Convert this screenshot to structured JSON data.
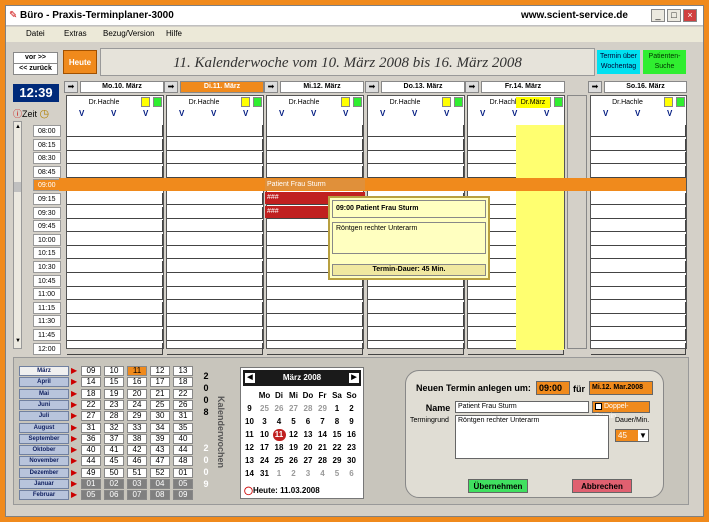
{
  "titlebar": {
    "title": "Büro - Praxis-Terminplaner-3000",
    "url": "www.scient-service.de"
  },
  "menu": [
    "Datei",
    "Extras",
    "Bezug/Version",
    "Hilfe"
  ],
  "nav": {
    "fwd": "vor >>",
    "back": "<< zurück",
    "today": "Heute"
  },
  "week": {
    "label": "11.  Kalenderwoche  vom  10. März 2008  bis   16. März 2008"
  },
  "buttons": {
    "termin_ueber": "Termin über Wochentag",
    "patienten": "Patienten-Suche"
  },
  "clock": "12:39",
  "zeit_label": "Zeit",
  "times": [
    "08:00",
    "08:15",
    "08:30",
    "08:45",
    "09:00",
    "09:15",
    "09:30",
    "09:45",
    "10:00",
    "10:15",
    "10:30",
    "10:45",
    "11:00",
    "11:15",
    "11:30",
    "11:45",
    "12:00"
  ],
  "days": [
    "Mo.10. März",
    "Di.11. März",
    "Mi.12. März",
    "Do.13. März",
    "Fr.14. März",
    "So.16. März"
  ],
  "doctor": "Dr.Hachle",
  "doctor2": "Dr.März",
  "v": "V",
  "appointment": {
    "short": "Patient Frau Sturm",
    "marker": "###"
  },
  "popup": {
    "head": "09:00   Patient Frau Sturm",
    "body": "Röntgen rechter Unterarm",
    "foot": "Termin-Dauer:  45 Min."
  },
  "months": [
    "März",
    "April",
    "Mai",
    "Juni",
    "Juli",
    "August",
    "September",
    "Oktober",
    "November",
    "Dezember",
    "Januar",
    "Februar"
  ],
  "kw": [
    [
      "09",
      "10",
      "11",
      "12",
      "13"
    ],
    [
      "14",
      "15",
      "16",
      "17",
      "18"
    ],
    [
      "18",
      "19",
      "20",
      "21",
      "22"
    ],
    [
      "22",
      "23",
      "24",
      "25",
      "26"
    ],
    [
      "27",
      "28",
      "29",
      "30",
      "31"
    ],
    [
      "31",
      "32",
      "33",
      "34",
      "35"
    ],
    [
      "36",
      "37",
      "38",
      "39",
      "40"
    ],
    [
      "40",
      "41",
      "42",
      "43",
      "44"
    ],
    [
      "44",
      "45",
      "46",
      "47",
      "48"
    ],
    [
      "49",
      "50",
      "51",
      "52",
      "01"
    ],
    [
      "01",
      "02",
      "03",
      "04",
      "05"
    ],
    [
      "05",
      "06",
      "07",
      "08",
      "09"
    ]
  ],
  "year_digits": [
    "2",
    "0",
    "0",
    "8"
  ],
  "year_digits2": [
    "2",
    "0",
    "0",
    "9"
  ],
  "kw_label": "Kalenderwochen",
  "calendar": {
    "title": "März 2008",
    "weekdays": [
      "Mo",
      "Di",
      "Mi",
      "Do",
      "Fr",
      "Sa",
      "So"
    ],
    "weeknums": [
      "9",
      "10",
      "11",
      "12",
      "13",
      "14"
    ],
    "rows": [
      [
        "25",
        "26",
        "27",
        "28",
        "29",
        "1",
        "2"
      ],
      [
        "3",
        "4",
        "5",
        "6",
        "7",
        "8",
        "9"
      ],
      [
        "10",
        "11",
        "12",
        "13",
        "14",
        "15",
        "16"
      ],
      [
        "17",
        "18",
        "19",
        "20",
        "21",
        "22",
        "23"
      ],
      [
        "24",
        "25",
        "26",
        "27",
        "28",
        "29",
        "30"
      ],
      [
        "31",
        "1",
        "2",
        "3",
        "4",
        "5",
        "6"
      ]
    ],
    "today_label": "Heute: 11.03.2008"
  },
  "new_appt": {
    "title": "Neuen Termin anlegen um:",
    "time": "09:00",
    "fuer": "für",
    "date": "Mi.12. Mar.2008",
    "name_label": "Name",
    "name_value": "Patient Frau Sturm",
    "doppel": "Doppel-Termin",
    "grund_label": "Termingrund",
    "grund_value": "Röntgen rechter Unterarm",
    "dauer_label": "Dauer/Min.",
    "dauer_value": "45",
    "ok": "Übernehmen",
    "cancel": "Abbrechen"
  }
}
